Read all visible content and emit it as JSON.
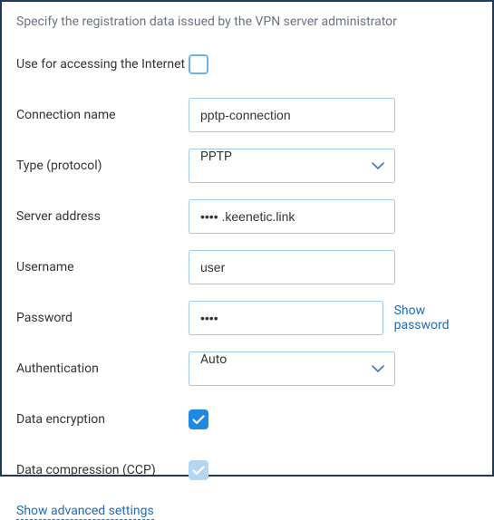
{
  "description": "Specify the registration data issued by the VPN server administrator",
  "fields": {
    "useInternet": {
      "label": "Use for accessing the Internet",
      "checked": false
    },
    "connectionName": {
      "label": "Connection name",
      "value": "pptp-connection"
    },
    "type": {
      "label": "Type (protocol)",
      "value": "PPTP"
    },
    "serverAddress": {
      "label": "Server address",
      "value": "•••• .keenetic.link"
    },
    "username": {
      "label": "Username",
      "value": "user"
    },
    "password": {
      "label": "Password",
      "value": "••••",
      "showLabel": "Show password"
    },
    "authentication": {
      "label": "Authentication",
      "value": "Auto"
    },
    "dataEncryption": {
      "label": "Data encryption",
      "checked": true
    },
    "dataCompression": {
      "label": "Data compression (CCP)",
      "checked": true
    }
  },
  "advancedLink": "Show advanced settings"
}
